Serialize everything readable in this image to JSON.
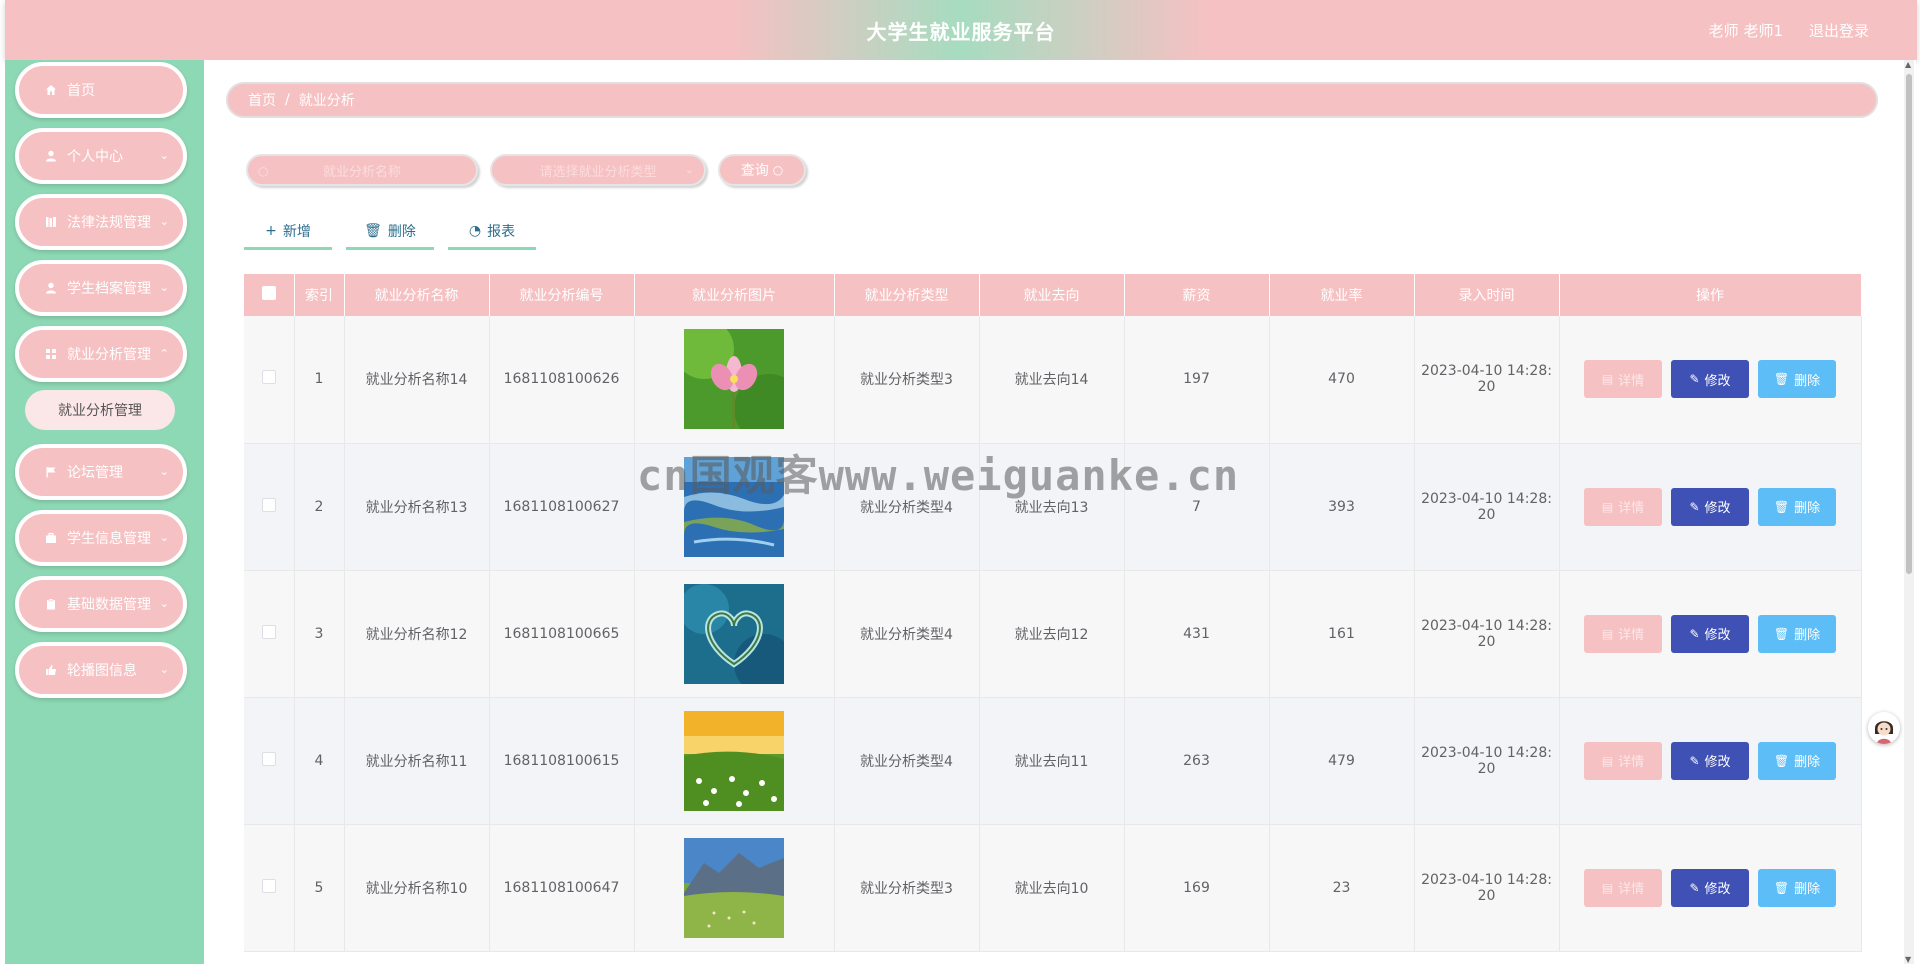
{
  "header": {
    "title": "大学生就业服务平台",
    "user": "老师 老师1",
    "logout": "退出登录"
  },
  "sidebar": {
    "items": [
      {
        "label": "首页",
        "icon": "home-icon"
      },
      {
        "label": "个人中心",
        "icon": "user-icon"
      },
      {
        "label": "法律法规管理",
        "icon": "books-icon"
      },
      {
        "label": "学生档案管理",
        "icon": "user-icon"
      },
      {
        "label": "就业分析管理",
        "icon": "grid-icon"
      },
      {
        "label": "论坛管理",
        "icon": "flag-icon"
      },
      {
        "label": "学生信息管理",
        "icon": "briefcase-icon"
      },
      {
        "label": "基础数据管理",
        "icon": "clipboard-icon"
      },
      {
        "label": "轮播图信息",
        "icon": "thumbs-up-icon"
      }
    ],
    "active_submenu": "就业分析管理"
  },
  "breadcrumb": {
    "home": "首页",
    "separator": "/",
    "current": "就业分析"
  },
  "search": {
    "name_placeholder": "就业分析名称",
    "type_placeholder": "请选择就业分析类型",
    "query_label": "查询"
  },
  "actions": {
    "add": "新增",
    "delete": "删除",
    "report": "报表"
  },
  "table": {
    "headers": [
      "索引",
      "就业分析名称",
      "就业分析编号",
      "就业分析图片",
      "就业分析类型",
      "就业去向",
      "薪资",
      "就业率",
      "录入时间",
      "操作"
    ],
    "rows": [
      {
        "index": "1",
        "name": "就业分析名称14",
        "code": "1681108100626",
        "image": "lotus-flower",
        "type": "就业分析类型3",
        "destination": "就业去向14",
        "salary": "197",
        "rate": "470",
        "time1": "2023-04-10 14:28:",
        "time2": "20"
      },
      {
        "index": "2",
        "name": "就业分析名称13",
        "code": "1681108100627",
        "image": "water-landscape",
        "type": "就业分析类型4",
        "destination": "就业去向13",
        "salary": "7",
        "rate": "393",
        "time1": "2023-04-10 14:28:",
        "time2": "20"
      },
      {
        "index": "3",
        "name": "就业分析名称12",
        "code": "1681108100665",
        "image": "heart-island",
        "type": "就业分析类型4",
        "destination": "就业去向12",
        "salary": "431",
        "rate": "161",
        "time1": "2023-04-10 14:28:",
        "time2": "20"
      },
      {
        "index": "4",
        "name": "就业分析名称11",
        "code": "1681108100615",
        "image": "flower-field-sunset",
        "type": "就业分析类型4",
        "destination": "就业去向11",
        "salary": "263",
        "rate": "479",
        "time1": "2023-04-10 14:28:",
        "time2": "20"
      },
      {
        "index": "5",
        "name": "就业分析名称10",
        "code": "1681108100647",
        "image": "mountain-meadow",
        "type": "就业分析类型3",
        "destination": "就业去向10",
        "salary": "169",
        "rate": "23",
        "time1": "2023-04-10 14:28:",
        "time2": "20"
      }
    ],
    "op_labels": {
      "detail": "详情",
      "edit": "修改",
      "delete": "删除"
    }
  },
  "watermark": "cn国观客www.weiguanke.cn",
  "colors": {
    "pink": "#f6c1c3",
    "mint": "#8ed9b5",
    "indigo": "#3f51b5",
    "sky": "#5dbdf7"
  }
}
